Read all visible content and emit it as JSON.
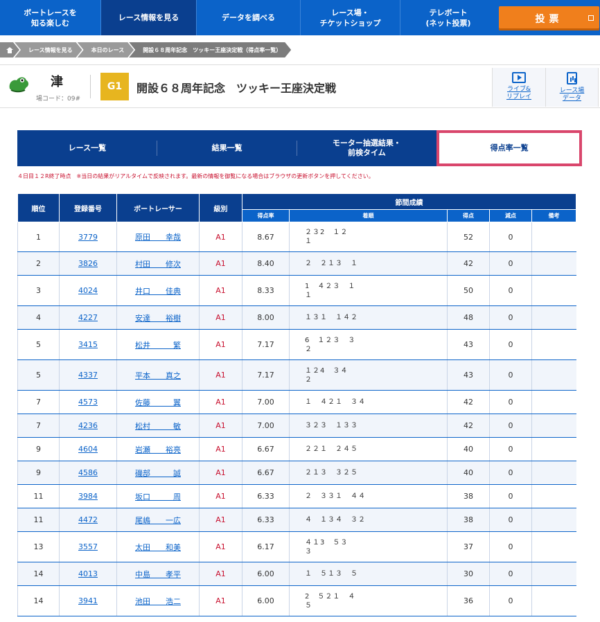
{
  "nav": {
    "items": [
      "ボートレースを\n知る楽しむ",
      "レース情報を見る",
      "データを調べる",
      "レース場・\nチケットショップ",
      "テレボート\n(ネット投票)"
    ],
    "vote": "投票"
  },
  "breadcrumb": [
    "レース情報を見る",
    "本日のレース",
    "開設６８周年記念　ツッキー王座決定戦（得点率一覧）"
  ],
  "venue": {
    "name": "津",
    "code": "場コード：09#",
    "grade": "G1",
    "title": "開設６８周年記念　ツッキー王座決定戦",
    "live_label": "ライブ&\nリプレイ",
    "data_label": "レース場\nデータ"
  },
  "tabs": [
    "レース一覧",
    "結果一覧",
    "モーター抽選結果・\n前検タイム",
    "得点率一覧"
  ],
  "notice": "４日目１２R終了時点　※当日の結果がリアルタイムで反映されます。最新の情報を御覧になる場合はブラウザの更新ボタンを押してください。",
  "table": {
    "headers": {
      "rank": "順位",
      "reg": "登録番号",
      "racer": "ボートレーサー",
      "class": "級別",
      "group": "節間成績",
      "rate": "得点率",
      "order": "着順",
      "points": "得点",
      "deduct": "減点",
      "remarks": "備考"
    },
    "rows": [
      {
        "rank": "1",
        "reg": "3779",
        "name": "原田　　幸哉",
        "cls": "A1",
        "rate": "8.67",
        "order": "２３2　１２\n１",
        "points": "52",
        "deduct": "0",
        "remarks": ""
      },
      {
        "rank": "2",
        "reg": "3826",
        "name": "村田　　修次",
        "cls": "A1",
        "rate": "8.40",
        "order": "２　２１３　１",
        "points": "42",
        "deduct": "0",
        "remarks": ""
      },
      {
        "rank": "3",
        "reg": "4024",
        "name": "井口　　佳典",
        "cls": "A1",
        "rate": "8.33",
        "order": "1　４２３　１\n１",
        "points": "50",
        "deduct": "0",
        "remarks": ""
      },
      {
        "rank": "4",
        "reg": "4227",
        "name": "安達　　裕樹",
        "cls": "A1",
        "rate": "8.00",
        "order": "１３１　１４２",
        "points": "48",
        "deduct": "0",
        "remarks": ""
      },
      {
        "rank": "5",
        "reg": "3415",
        "name": "松井　　　繁",
        "cls": "A1",
        "rate": "7.17",
        "order": "6　１２３　３\n２",
        "points": "43",
        "deduct": "0",
        "remarks": ""
      },
      {
        "rank": "5",
        "reg": "4337",
        "name": "平本　　真之",
        "cls": "A1",
        "rate": "7.17",
        "order": "１２4　３４\n２",
        "points": "43",
        "deduct": "0",
        "remarks": ""
      },
      {
        "rank": "7",
        "reg": "4573",
        "name": "佐藤　　　翼",
        "cls": "A1",
        "rate": "7.00",
        "order": "１　４２１　３４",
        "points": "42",
        "deduct": "0",
        "remarks": ""
      },
      {
        "rank": "7",
        "reg": "4236",
        "name": "松村　　　敏",
        "cls": "A1",
        "rate": "7.00",
        "order": "３２３　１３３",
        "points": "42",
        "deduct": "0",
        "remarks": ""
      },
      {
        "rank": "9",
        "reg": "4604",
        "name": "岩瀬　　裕亮",
        "cls": "A1",
        "rate": "6.67",
        "order": "２２１　２４５",
        "points": "40",
        "deduct": "0",
        "remarks": ""
      },
      {
        "rank": "9",
        "reg": "4586",
        "name": "磯部　　　誠",
        "cls": "A1",
        "rate": "6.67",
        "order": "２１３　３２５",
        "points": "40",
        "deduct": "0",
        "remarks": ""
      },
      {
        "rank": "11",
        "reg": "3984",
        "name": "坂口　　　周",
        "cls": "A1",
        "rate": "6.33",
        "order": "２　３３１　４４",
        "points": "38",
        "deduct": "0",
        "remarks": ""
      },
      {
        "rank": "11",
        "reg": "4472",
        "name": "尾嶋　　一広",
        "cls": "A1",
        "rate": "6.33",
        "order": "４　１３４　３２",
        "points": "38",
        "deduct": "0",
        "remarks": ""
      },
      {
        "rank": "13",
        "reg": "3557",
        "name": "太田　　和美",
        "cls": "A1",
        "rate": "6.17",
        "order": "４１3　５３\n３",
        "points": "37",
        "deduct": "0",
        "remarks": ""
      },
      {
        "rank": "14",
        "reg": "4013",
        "name": "中島　　孝平",
        "cls": "A1",
        "rate": "6.00",
        "order": "１　５１３　５",
        "points": "30",
        "deduct": "0",
        "remarks": ""
      },
      {
        "rank": "14",
        "reg": "3941",
        "name": "池田　　浩二",
        "cls": "A1",
        "rate": "6.00",
        "order": "2　５２１　４\n５",
        "points": "36",
        "deduct": "0",
        "remarks": ""
      }
    ]
  }
}
